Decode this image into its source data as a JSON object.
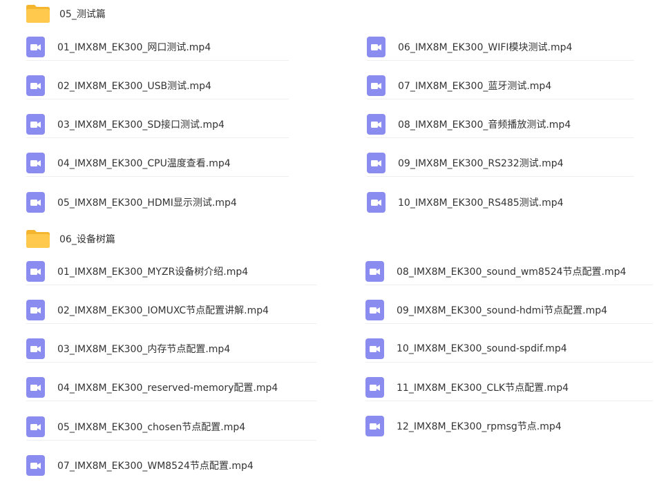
{
  "icons": {
    "folder": "folder-icon",
    "video": "video-icon"
  },
  "colors": {
    "folder": "#FFC94D",
    "folder_tab": "#F5B52E",
    "video": "#8A8CF0"
  },
  "groups": [
    {
      "folder": "05_测试篇",
      "left": [
        "01_IMX8M_EK300_网口测试.mp4",
        "02_IMX8M_EK300_USB测试.mp4",
        "03_IMX8M_EK300_SD接口测试.mp4",
        "04_IMX8M_EK300_CPU温度查看.mp4",
        "05_IMX8M_EK300_HDMI显示测试.mp4"
      ],
      "right": [
        "06_IMX8M_EK300_WIFI模块测试.mp4",
        "07_IMX8M_EK300_蓝牙测试.mp4",
        "08_IMX8M_EK300_音频播放测试.mp4",
        "09_IMX8M_EK300_RS232测试.mp4",
        "10_IMX8M_EK300_RS485测试.mp4"
      ]
    },
    {
      "folder": "06_设备树篇",
      "left": [
        "01_IMX8M_EK300_MYZR设备树介绍.mp4",
        "02_IMX8M_EK300_IOMUXC节点配置讲解.mp4",
        "03_IMX8M_EK300_内存节点配置.mp4",
        "04_IMX8M_EK300_reserved-memory配置.mp4",
        "05_IMX8M_EK300_chosen节点配置.mp4",
        "07_IMX8M_EK300_WM8524节点配置.mp4"
      ],
      "right": [
        "08_IMX8M_EK300_sound_wm8524节点配置.mp4",
        "09_IMX8M_EK300_sound-hdmi节点配置.mp4",
        "10_IMX8M_EK300_sound-spdif.mp4",
        "11_IMX8M_EK300_CLK节点配置.mp4",
        "12_IMX8M_EK300_rpmsg节点.mp4"
      ]
    }
  ]
}
